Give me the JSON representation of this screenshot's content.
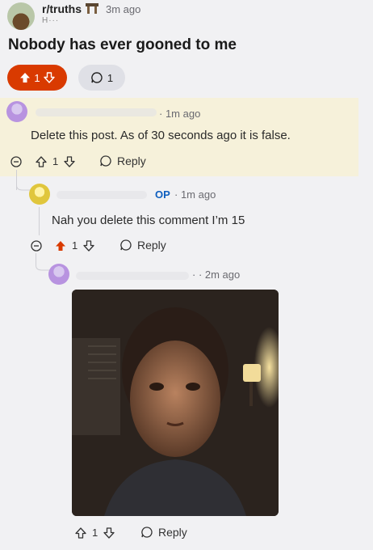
{
  "header": {
    "subreddit": "r/truths",
    "post_time": "3m ago",
    "username_partial": "H···"
  },
  "post": {
    "title": "Nobody has ever gooned to me",
    "votes": "1",
    "comments": "1"
  },
  "comments": [
    {
      "meta": "· 1m ago",
      "text": "Delete this post. As of 30 seconds ago it is false.",
      "votes": "1",
      "reply_label": "Reply"
    },
    {
      "op_label": "OP",
      "meta": "· 1m ago",
      "text": "Nah you delete this comment I’m 15",
      "votes": "1",
      "reply_label": "Reply"
    },
    {
      "meta": "· · 2m ago",
      "votes": "1",
      "reply_label": "Reply"
    }
  ],
  "colors": {
    "upvote_active": "#d93a00",
    "op_blue": "#0f5fbf"
  }
}
